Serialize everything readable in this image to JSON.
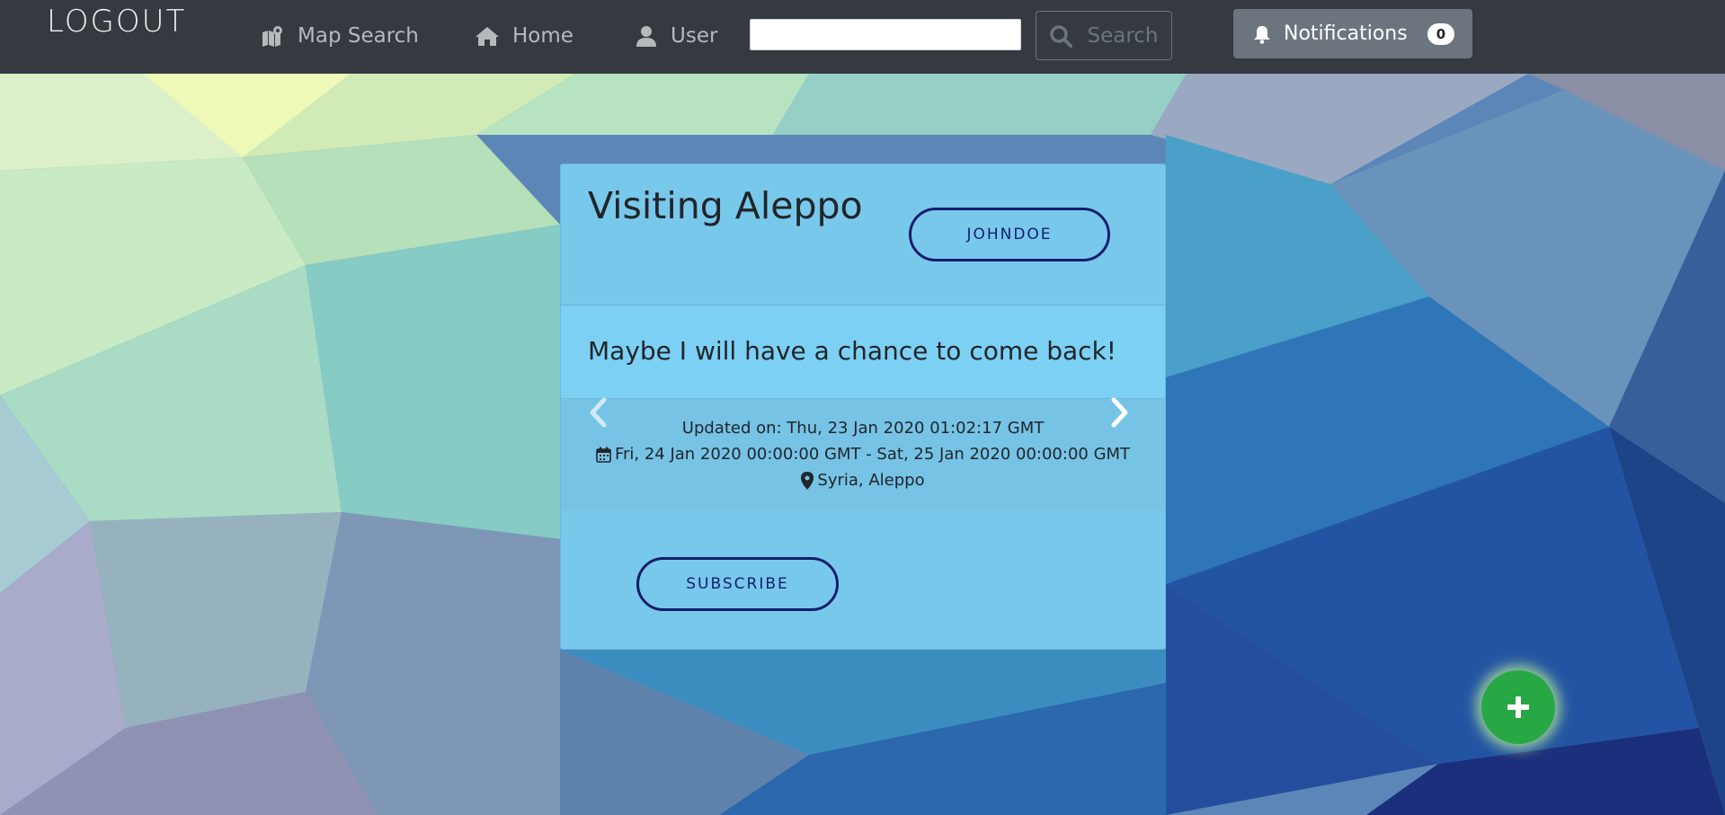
{
  "navbar": {
    "brand": "LOGOUT",
    "map_search_label": "Map Search",
    "home_label": "Home",
    "user_label": "User",
    "search_value": "",
    "search_button_label": "Search",
    "notifications_label": "Notifications",
    "notifications_count": "0",
    "bg_color": "#343a40"
  },
  "card": {
    "title": "Visiting Aleppo",
    "author_button": "JOHNDOE",
    "message": "Maybe I will have a chance to come back!",
    "updated": "Updated on: Thu, 23 Jan 2020 01:02:17 GMT",
    "dates": "Fri, 24 Jan 2020 00:00:00 GMT -  Sat, 25 Jan 2020 00:00:00 GMT",
    "location": "Syria,  Aleppo",
    "subscribe_button": "SUBSCRIBE",
    "bg_color": "#78c8ec",
    "button_color": "#141e6b"
  },
  "icons": {
    "map": "map-icon",
    "home": "home-icon",
    "user": "user-icon",
    "search": "search-icon",
    "bell": "bell-icon",
    "calendar": "calendar-icon",
    "location": "map-marker-icon",
    "prev": "chevron-left-icon",
    "next": "chevron-right-icon",
    "add": "plus-icon"
  },
  "fab": {
    "color": "#28a745"
  }
}
